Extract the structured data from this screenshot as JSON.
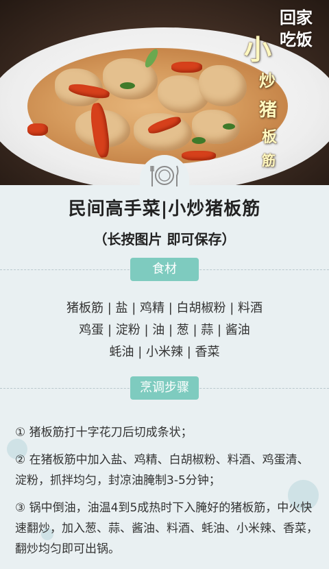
{
  "brand": {
    "line1": "回家",
    "line2": "吃饭"
  },
  "photo_title": {
    "c1": "小",
    "c2": "炒",
    "c3": "猪",
    "c4": "板",
    "c5": "筋"
  },
  "title": "民间高手菜|小炒猪板筋",
  "subtitle": "（长按图片 即可保存）",
  "ingredients_label": "食材",
  "ingredients_lines": [
    "猪板筋 | 盐 | 鸡精 | 白胡椒粉 | 料酒",
    "鸡蛋 | 淀粉 | 油 | 葱 | 蒜 | 酱油",
    "蚝油 | 小米辣 | 香菜"
  ],
  "steps_label": "烹调步骤",
  "steps": [
    "① 猪板筋打十字花刀后切成条状；",
    "② 在猪板筋中加入盐、鸡精、白胡椒粉、料酒、鸡蛋清、淀粉，抓拌均匀，封凉油腌制3-5分钟；",
    "③ 锅中倒油，油温4到5成热时下入腌好的猪板筋，中火快速翻炒，加入葱、蒜、酱油、料酒、蚝油、小米辣、香菜，翻炒均匀即可出锅。"
  ],
  "colors": {
    "accent": "#7ecbbf",
    "background": "#e9f0f2"
  },
  "icons": {
    "divider": "plate-fork-knife-icon"
  }
}
